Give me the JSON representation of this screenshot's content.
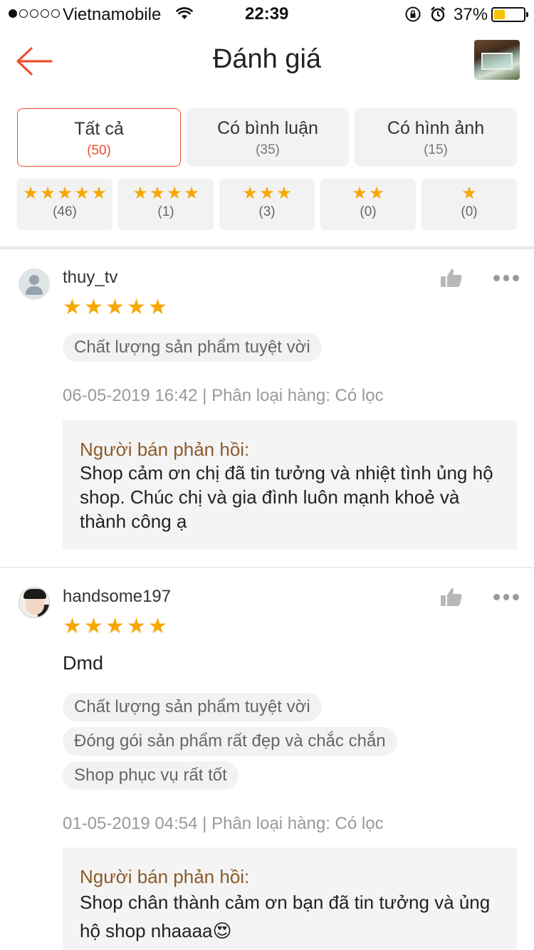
{
  "status_bar": {
    "carrier": "Vietnamobile",
    "time": "22:39",
    "battery_percent": "37%",
    "battery_level": 0.37,
    "signal_bars_filled": 1
  },
  "header": {
    "title": "Đánh giá",
    "back_icon": "arrow-left-icon",
    "accent_color": "#ee4d2d"
  },
  "filters": {
    "tabs": [
      {
        "label": "Tất cả",
        "count": "(50)",
        "active": true
      },
      {
        "label": "Có bình luận",
        "count": "(35)",
        "active": false
      },
      {
        "label": "Có hình ảnh",
        "count": "(15)",
        "active": false
      }
    ],
    "star_filters": [
      {
        "stars": 5,
        "count": "(46)"
      },
      {
        "stars": 4,
        "count": "(1)"
      },
      {
        "stars": 3,
        "count": "(3)"
      },
      {
        "stars": 2,
        "count": "(0)"
      },
      {
        "stars": 1,
        "count": "(0)"
      }
    ]
  },
  "reviews": [
    {
      "username": "thuy_tv",
      "rating": 5,
      "comment": "",
      "tags": [
        "Chất lượng sản phẩm tuyệt vời"
      ],
      "meta": "06-05-2019 16:42 | Phân loại hàng: Có lọc",
      "reply_title": "Người bán phản hồi:",
      "reply_text": "Shop cảm ơn chị đã tin tưởng và nhiệt tình ủng hộ shop. Chúc chị và gia đình luôn mạnh khoẻ và thành công ạ"
    },
    {
      "username": "handsome197",
      "rating": 5,
      "comment": "Dmd",
      "tags": [
        "Chất lượng sản phẩm tuyệt vời",
        "Đóng gói sản phẩm rất đẹp và chắc chắn",
        "Shop phục vụ rất tốt"
      ],
      "meta": "01-05-2019 04:54 | Phân loại hàng: Có lọc",
      "reply_title": "Người bán phản hồi:",
      "reply_text": "Shop chân thành cảm ơn bạn đã tin tưởng và ủng hộ shop nhaaaa😍"
    }
  ]
}
